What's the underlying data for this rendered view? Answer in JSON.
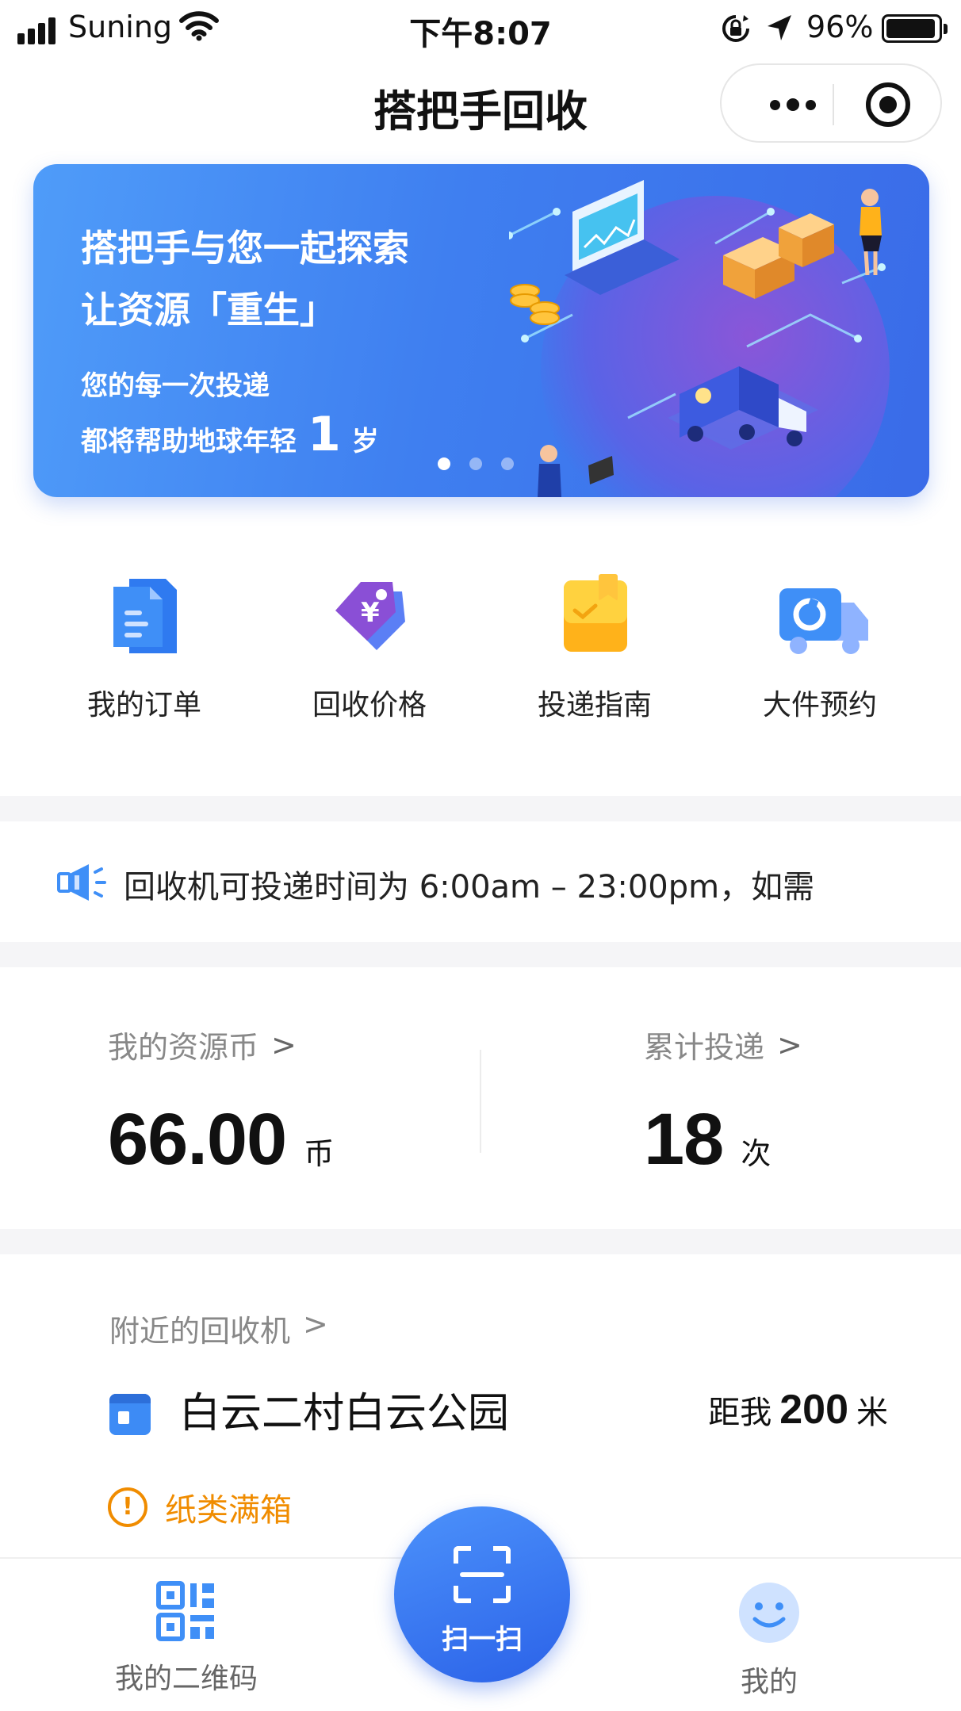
{
  "status_bar": {
    "carrier": "Suning",
    "time": "下午8:07",
    "battery_percent": "96%",
    "battery_level": 0.96
  },
  "nav": {
    "title": "搭把手回收",
    "capsule_icons": [
      "more-icon",
      "close-target-icon"
    ]
  },
  "banner": {
    "headline_1": "搭把手与您一起探索",
    "headline_2": "让资源「重生」",
    "sub_1": "您的每一次投递",
    "sub_2_prefix": "都将帮助地球年轻",
    "sub_2_number": "1",
    "sub_2_suffix": "岁",
    "dots_total": 3,
    "dots_active_index": 0,
    "background_color": "#3f7ff0"
  },
  "quick_actions": [
    {
      "label": "我的订单",
      "icon": "document-icon"
    },
    {
      "label": "回收价格",
      "icon": "price-tag-icon"
    },
    {
      "label": "投递指南",
      "icon": "guide-folder-icon"
    },
    {
      "label": "大件预约",
      "icon": "truck-icon"
    }
  ],
  "notice": {
    "icon": "speaker-icon",
    "text": "回收机可投递时间为 6:00am – 23:00pm，如需"
  },
  "stats": {
    "coins": {
      "label": "我的资源币",
      "value": "66.00",
      "unit": "币"
    },
    "deliveries": {
      "label": "累计投递",
      "value": "18",
      "unit": "次"
    },
    "chevron": ">"
  },
  "nearby": {
    "label": "附近的回收机",
    "chevron": ">",
    "machine_name": "白云二村白云公园",
    "distance_prefix": "距我",
    "distance_value": "200",
    "distance_unit": "米",
    "warning_icon": "!",
    "warning_text": "纸类满箱",
    "warning_color": "#f08c00"
  },
  "tab_bar": {
    "left": {
      "label": "我的二维码",
      "icon": "qr-code-icon"
    },
    "center": {
      "label": "扫一扫",
      "icon": "scan-icon"
    },
    "right": {
      "label": "我的",
      "icon": "smile-icon"
    },
    "accent_color": "#2b62e8"
  }
}
